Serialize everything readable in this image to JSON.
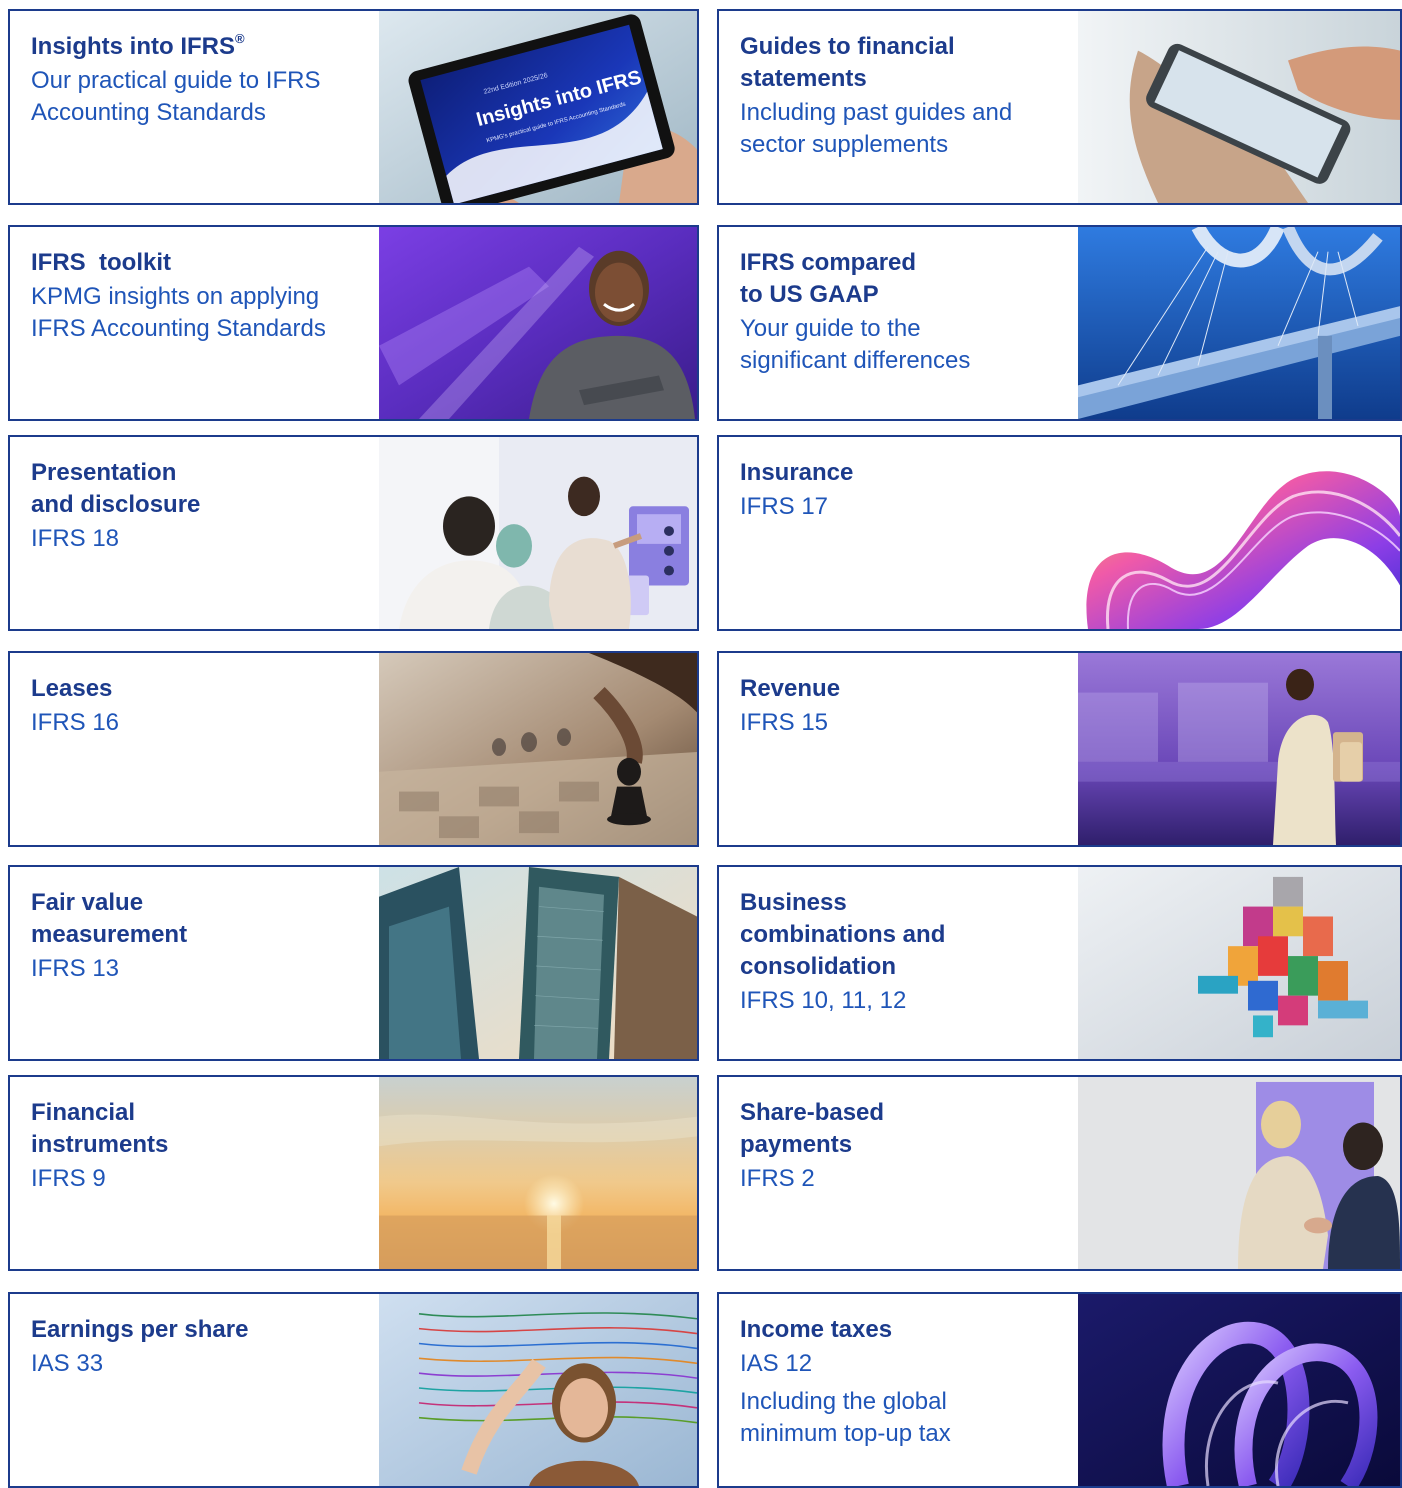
{
  "cards": [
    {
      "title": "Insights into IFRS",
      "title_mark": "®",
      "subtitle": "Our practical guide to IFRS Accounting Standards",
      "image": "tablet-photo"
    },
    {
      "title": "Guides to financial statements",
      "subtitle": "Including past guides and sector supplements",
      "image": "phone-photo"
    },
    {
      "title": "IFRS  toolkit",
      "subtitle": "KPMG insights on applying IFRS Accounting Standards",
      "image": "woman-portrait-photo"
    },
    {
      "title": "IFRS compared to US GAAP",
      "subtitle": "Your guide to the significant differences",
      "image": "bridge-photo"
    },
    {
      "title": "Presentation and disclosure",
      "subtitle": "IFRS 18",
      "image": "meeting-photo"
    },
    {
      "title": "Insurance",
      "subtitle": "IFRS 17",
      "image": "ribbon-art"
    },
    {
      "title": "Leases",
      "subtitle": "IFRS 16",
      "image": "chess-photo"
    },
    {
      "title": "Revenue",
      "subtitle": "IFRS 15",
      "image": "shopper-photo"
    },
    {
      "title": "Fair value measurement",
      "subtitle": "IFRS 13",
      "image": "skyscraper-photo"
    },
    {
      "title": "Business combinations and consolidation",
      "subtitle": "IFRS 10, 11, 12",
      "image": "blocks-photo"
    },
    {
      "title": "Financial instruments",
      "subtitle": "IFRS 9",
      "image": "sunset-photo"
    },
    {
      "title": "Share-based payments",
      "subtitle": "IFRS 2",
      "image": "handshake-photo"
    },
    {
      "title": "Earnings per share",
      "subtitle": "IAS 33",
      "image": "data-screen-photo"
    },
    {
      "title": "Income taxes",
      "subtitle": "IAS 12",
      "subtitle2": "Including the global minimum top-up tax",
      "image": "abstract-loops-art"
    }
  ],
  "tablet_text": {
    "edition": "22nd Edition 2025/26",
    "heading": "Insights into IFRS",
    "tagline": "KPMG's practical guide to IFRS Accounting Standards"
  }
}
